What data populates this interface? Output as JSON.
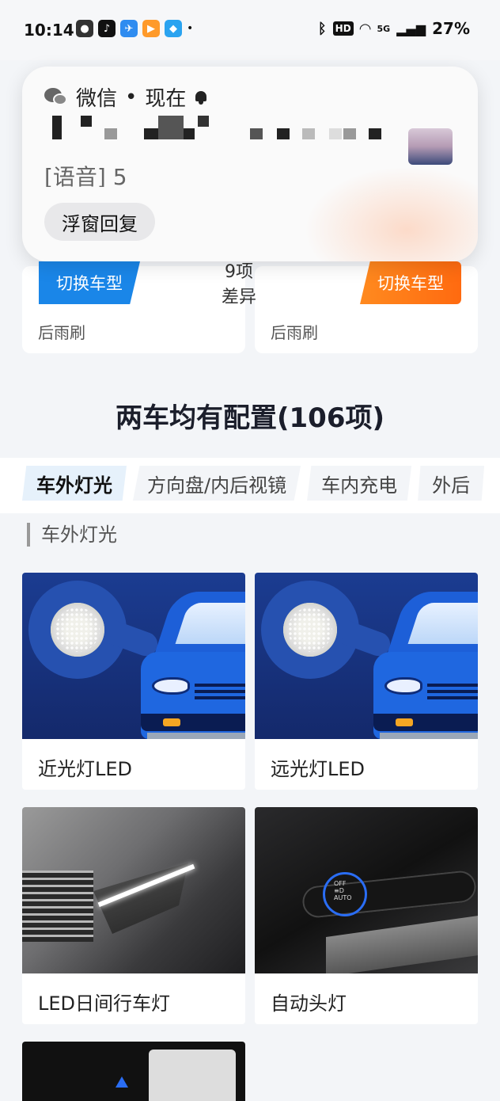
{
  "status_bar": {
    "time": "10:14",
    "app_icons": [
      "wechat-icon",
      "tiktok-icon",
      "app-icon-2",
      "app-icon-3",
      "app-icon-4"
    ],
    "hd_label": "HD",
    "network_label": "5G",
    "battery": "27%"
  },
  "notification": {
    "app_name": "微信",
    "separator": "•",
    "time": "现在",
    "message": "[语音] 5",
    "reply_label": "浮窗回复"
  },
  "compare": {
    "left_switch_label": "切换车型",
    "right_switch_label": "切换车型",
    "diff_count": "9项",
    "diff_label": "差异",
    "left_cut_text": "后雨刷",
    "right_cut_text": "后雨刷"
  },
  "section": {
    "title": "两车均有配置(106项)"
  },
  "tabs": [
    {
      "label": "车外灯光",
      "active": true
    },
    {
      "label": "方向盘/内后视镜",
      "active": false
    },
    {
      "label": "车内充电",
      "active": false
    },
    {
      "label": "外后",
      "active": false
    }
  ],
  "category": {
    "label": "车外灯光"
  },
  "features": [
    {
      "label": "近光灯LED"
    },
    {
      "label": "远光灯LED"
    },
    {
      "label": "LED日间行车灯"
    },
    {
      "label": "自动头灯"
    }
  ],
  "colors": {
    "accent_blue": "#1a86e8",
    "accent_orange": "#ff7a18",
    "tab_active_bg": "#e6f1fb",
    "page_bg": "#f3f5f8"
  }
}
